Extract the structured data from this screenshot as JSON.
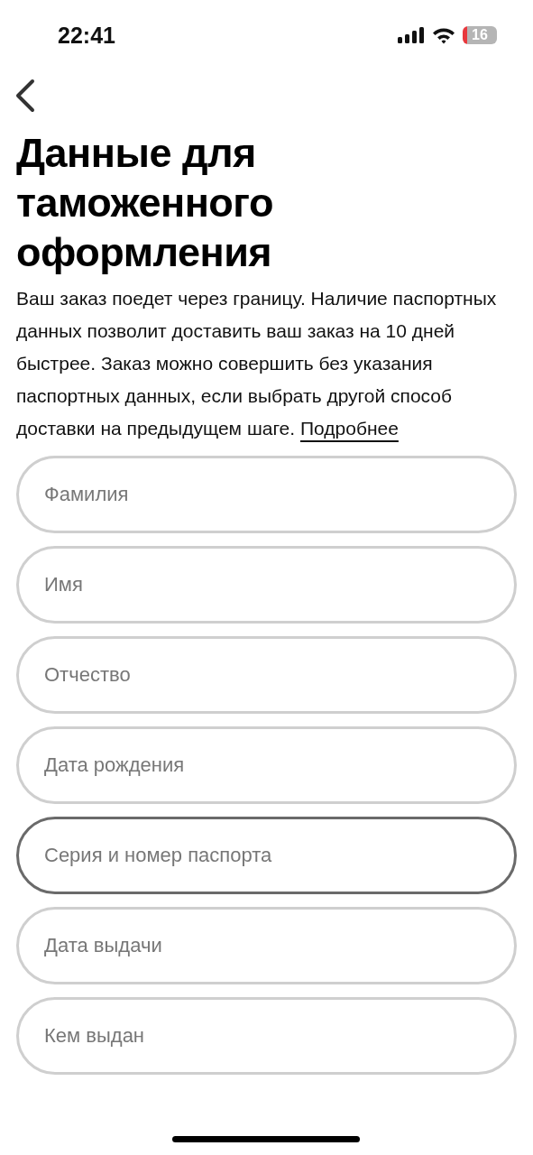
{
  "status_bar": {
    "time": "22:41",
    "battery": "16"
  },
  "title": "Данные для таможенного оформления",
  "description": {
    "text": "Ваш заказ поедет через границу. Наличие паспортных данных позволит доставить ваш заказ на 10 дней быстрее. Заказ можно совершить без указания паспортных данных, если выбрать другой способ доставки на предыдущем шаге.",
    "link": "Подробнее"
  },
  "fields": [
    {
      "placeholder": "Фамилия",
      "focused": false
    },
    {
      "placeholder": "Имя",
      "focused": false
    },
    {
      "placeholder": "Отчество",
      "focused": false
    },
    {
      "placeholder": "Дата рождения",
      "focused": false
    },
    {
      "placeholder": "Серия и номер паспорта",
      "focused": true
    },
    {
      "placeholder": "Дата выдачи",
      "focused": false
    },
    {
      "placeholder": "Кем выдан",
      "focused": false
    }
  ]
}
